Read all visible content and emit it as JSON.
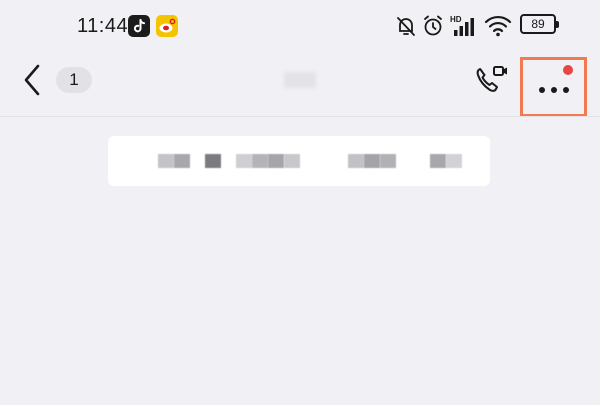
{
  "status_bar": {
    "time": "11:44",
    "battery": "89",
    "icons": [
      "tiktok-icon",
      "weibo-icon",
      "mute-icon",
      "alarm-icon",
      "signal-icon",
      "wifi-icon",
      "battery-icon"
    ]
  },
  "nav": {
    "unread_count": "1",
    "icons": [
      "back-icon",
      "video-call-icon",
      "more-icon"
    ]
  },
  "colors": {
    "background": "#f1f1f5",
    "highlight": "#f27a50",
    "notification_dot": "#e84545"
  }
}
